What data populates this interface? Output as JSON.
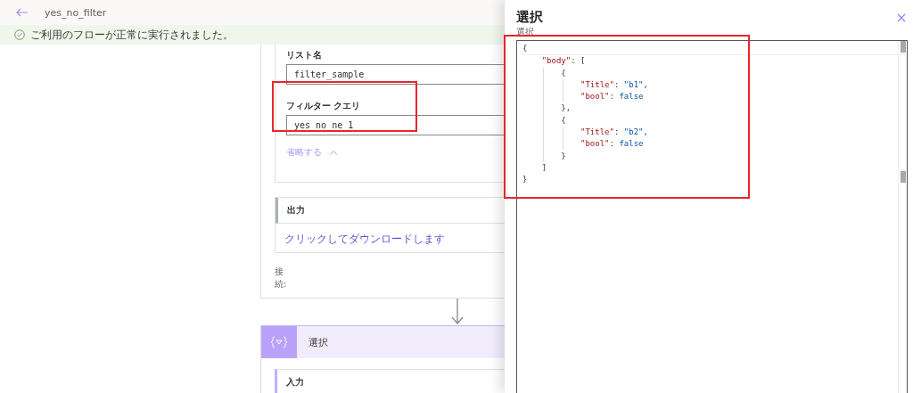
{
  "header": {
    "title": "yes_no_filter"
  },
  "notification": {
    "text": "ご利用のフローが正常に実行されました。"
  },
  "action_card": {
    "fields": [
      {
        "label": "リスト名",
        "value": "filter_sample"
      },
      {
        "label": "フィルター クエリ",
        "value": "yes_no ne 1"
      }
    ],
    "collapse_link": "省略する",
    "output": {
      "title": "出力",
      "link": "クリックしてダウンロードします"
    },
    "connection_label": "接続:"
  },
  "select_card": {
    "title": "選択",
    "input_section": "入力"
  },
  "panel": {
    "title": "選択",
    "editor_label": "選択",
    "code_lines": [
      "{",
      "    \"body\": [",
      "        {",
      "            \"Title\": \"b1\",",
      "            \"bool\": false",
      "        },",
      "        {",
      "            \"Title\": \"b2\",",
      "            \"bool\": false",
      "        }",
      "    ]",
      "}"
    ]
  }
}
